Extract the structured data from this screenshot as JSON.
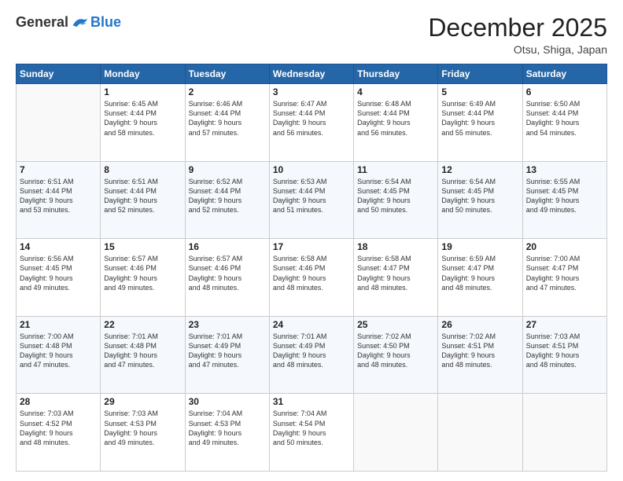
{
  "logo": {
    "general": "General",
    "blue": "Blue"
  },
  "header": {
    "month": "December 2025",
    "location": "Otsu, Shiga, Japan"
  },
  "weekdays": [
    "Sunday",
    "Monday",
    "Tuesday",
    "Wednesday",
    "Thursday",
    "Friday",
    "Saturday"
  ],
  "weeks": [
    [
      {
        "day": null,
        "info": null
      },
      {
        "day": "1",
        "info": "Sunrise: 6:45 AM\nSunset: 4:44 PM\nDaylight: 9 hours\nand 58 minutes."
      },
      {
        "day": "2",
        "info": "Sunrise: 6:46 AM\nSunset: 4:44 PM\nDaylight: 9 hours\nand 57 minutes."
      },
      {
        "day": "3",
        "info": "Sunrise: 6:47 AM\nSunset: 4:44 PM\nDaylight: 9 hours\nand 56 minutes."
      },
      {
        "day": "4",
        "info": "Sunrise: 6:48 AM\nSunset: 4:44 PM\nDaylight: 9 hours\nand 56 minutes."
      },
      {
        "day": "5",
        "info": "Sunrise: 6:49 AM\nSunset: 4:44 PM\nDaylight: 9 hours\nand 55 minutes."
      },
      {
        "day": "6",
        "info": "Sunrise: 6:50 AM\nSunset: 4:44 PM\nDaylight: 9 hours\nand 54 minutes."
      }
    ],
    [
      {
        "day": "7",
        "info": "Sunrise: 6:51 AM\nSunset: 4:44 PM\nDaylight: 9 hours\nand 53 minutes."
      },
      {
        "day": "8",
        "info": "Sunrise: 6:51 AM\nSunset: 4:44 PM\nDaylight: 9 hours\nand 52 minutes."
      },
      {
        "day": "9",
        "info": "Sunrise: 6:52 AM\nSunset: 4:44 PM\nDaylight: 9 hours\nand 52 minutes."
      },
      {
        "day": "10",
        "info": "Sunrise: 6:53 AM\nSunset: 4:44 PM\nDaylight: 9 hours\nand 51 minutes."
      },
      {
        "day": "11",
        "info": "Sunrise: 6:54 AM\nSunset: 4:45 PM\nDaylight: 9 hours\nand 50 minutes."
      },
      {
        "day": "12",
        "info": "Sunrise: 6:54 AM\nSunset: 4:45 PM\nDaylight: 9 hours\nand 50 minutes."
      },
      {
        "day": "13",
        "info": "Sunrise: 6:55 AM\nSunset: 4:45 PM\nDaylight: 9 hours\nand 49 minutes."
      }
    ],
    [
      {
        "day": "14",
        "info": "Sunrise: 6:56 AM\nSunset: 4:45 PM\nDaylight: 9 hours\nand 49 minutes."
      },
      {
        "day": "15",
        "info": "Sunrise: 6:57 AM\nSunset: 4:46 PM\nDaylight: 9 hours\nand 49 minutes."
      },
      {
        "day": "16",
        "info": "Sunrise: 6:57 AM\nSunset: 4:46 PM\nDaylight: 9 hours\nand 48 minutes."
      },
      {
        "day": "17",
        "info": "Sunrise: 6:58 AM\nSunset: 4:46 PM\nDaylight: 9 hours\nand 48 minutes."
      },
      {
        "day": "18",
        "info": "Sunrise: 6:58 AM\nSunset: 4:47 PM\nDaylight: 9 hours\nand 48 minutes."
      },
      {
        "day": "19",
        "info": "Sunrise: 6:59 AM\nSunset: 4:47 PM\nDaylight: 9 hours\nand 48 minutes."
      },
      {
        "day": "20",
        "info": "Sunrise: 7:00 AM\nSunset: 4:47 PM\nDaylight: 9 hours\nand 47 minutes."
      }
    ],
    [
      {
        "day": "21",
        "info": "Sunrise: 7:00 AM\nSunset: 4:48 PM\nDaylight: 9 hours\nand 47 minutes."
      },
      {
        "day": "22",
        "info": "Sunrise: 7:01 AM\nSunset: 4:48 PM\nDaylight: 9 hours\nand 47 minutes."
      },
      {
        "day": "23",
        "info": "Sunrise: 7:01 AM\nSunset: 4:49 PM\nDaylight: 9 hours\nand 47 minutes."
      },
      {
        "day": "24",
        "info": "Sunrise: 7:01 AM\nSunset: 4:49 PM\nDaylight: 9 hours\nand 48 minutes."
      },
      {
        "day": "25",
        "info": "Sunrise: 7:02 AM\nSunset: 4:50 PM\nDaylight: 9 hours\nand 48 minutes."
      },
      {
        "day": "26",
        "info": "Sunrise: 7:02 AM\nSunset: 4:51 PM\nDaylight: 9 hours\nand 48 minutes."
      },
      {
        "day": "27",
        "info": "Sunrise: 7:03 AM\nSunset: 4:51 PM\nDaylight: 9 hours\nand 48 minutes."
      }
    ],
    [
      {
        "day": "28",
        "info": "Sunrise: 7:03 AM\nSunset: 4:52 PM\nDaylight: 9 hours\nand 48 minutes."
      },
      {
        "day": "29",
        "info": "Sunrise: 7:03 AM\nSunset: 4:53 PM\nDaylight: 9 hours\nand 49 minutes."
      },
      {
        "day": "30",
        "info": "Sunrise: 7:04 AM\nSunset: 4:53 PM\nDaylight: 9 hours\nand 49 minutes."
      },
      {
        "day": "31",
        "info": "Sunrise: 7:04 AM\nSunset: 4:54 PM\nDaylight: 9 hours\nand 50 minutes."
      },
      {
        "day": null,
        "info": null
      },
      {
        "day": null,
        "info": null
      },
      {
        "day": null,
        "info": null
      }
    ]
  ]
}
